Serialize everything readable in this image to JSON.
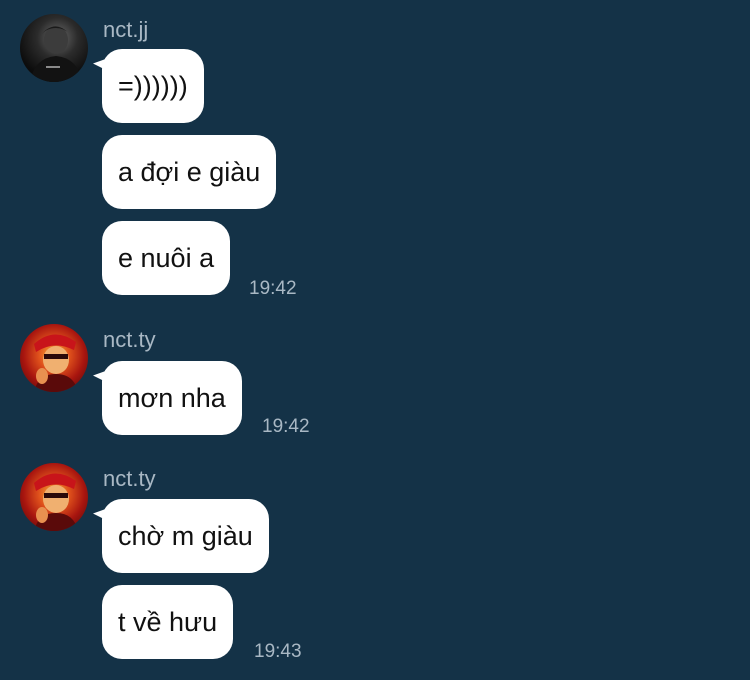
{
  "groups": [
    {
      "sender": "nct.jj",
      "avatar": "profile-photo-dark",
      "messages": [
        {
          "text": "=))))))"
        },
        {
          "text": "a đợi e giàu"
        },
        {
          "text": "e nuôi a",
          "time": "19:42"
        }
      ]
    },
    {
      "sender": "nct.ty",
      "avatar": "profile-photo-red",
      "messages": [
        {
          "text": "mơn nha",
          "time": "19:42"
        }
      ]
    },
    {
      "sender": "nct.ty",
      "avatar": "profile-photo-red",
      "messages": [
        {
          "text": "chờ m giàu"
        },
        {
          "text": "t về hưu",
          "time": "19:43"
        }
      ]
    }
  ],
  "colors": {
    "background": "#143247",
    "bubble": "#ffffff",
    "meta_text": "#a9b8c4"
  }
}
